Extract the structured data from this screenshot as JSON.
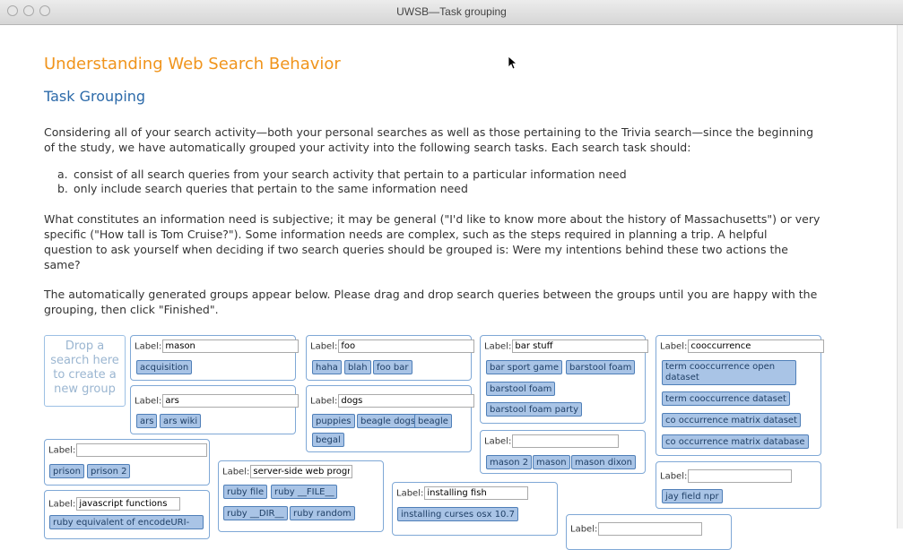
{
  "window": {
    "title": "UWSB—Task grouping"
  },
  "page": {
    "heading": "Understanding Web Search Behavior",
    "subheading": "Task Grouping",
    "intro_1": "Considering all of your search activity—both your personal searches as well as those pertaining to the Trivia search—since the beginning",
    "intro_2": "of the study, we have automatically grouped your activity into the following search tasks. Each search task should:",
    "criteria": [
      {
        "marker": "a.",
        "text": "consist of all search queries from your search activity that pertain to a particular information need"
      },
      {
        "marker": "b.",
        "text": "only include search queries that pertain to the same information need"
      }
    ],
    "info_1": "What constitutes an information need is subjective; it may be general (\"I'd like to know more about the history of Massachusetts\") or very",
    "info_2": "specific (\"How tall is Tom Cruise?\"). Some information needs are complex, such as the steps required in planning a trip. A helpful",
    "info_3": "question to ask yourself when deciding if two search queries should be grouped is: Were my intentions behind these two actions the",
    "info_4": "same?",
    "auto_1": "The automatically generated groups appear below. Please drag and drop search queries between the groups until you are happy with the",
    "auto_2": "grouping, then click \"Finished\".",
    "drop_zone": "Drop a search here to create a new group",
    "label_prefix": "Label:"
  },
  "groups": [
    {
      "label": "mason",
      "queries": [
        "acquisition"
      ]
    },
    {
      "label": "foo",
      "queries": [
        "haha",
        "blah",
        "foo bar"
      ]
    },
    {
      "label": "bar stuff",
      "queries": [
        "bar sport game",
        "barstool foam",
        "barstool foam",
        "barstool foam party"
      ]
    },
    {
      "label": "cooccurrence",
      "queries": [
        "term cooccurrence open dataset",
        "term cooccurrence dataset",
        "co occurrence matrix dataset",
        "co occurrence matrix database"
      ]
    },
    {
      "label": "ars",
      "queries": [
        "ars",
        "ars wiki"
      ]
    },
    {
      "label": "dogs",
      "queries": [
        "puppies",
        "beagle dogs",
        "beagle",
        "begal"
      ]
    },
    {
      "label": "",
      "queries": [
        "mason 2",
        "mason",
        "mason dixon"
      ]
    },
    {
      "label": "",
      "queries": [
        "jay field npr"
      ]
    },
    {
      "label": "",
      "queries": [
        "prison",
        "prison 2"
      ]
    },
    {
      "label": "server-side web progr",
      "queries": [
        "ruby file",
        "ruby __FILE__",
        "ruby __DIR__",
        "ruby random"
      ]
    },
    {
      "label": "installing fish",
      "queries": [
        "installing curses osx 10.7"
      ]
    },
    {
      "label": "javascript functions",
      "queries": [
        "ruby equivalent of encodeURI-"
      ]
    },
    {
      "label": "",
      "queries": []
    }
  ]
}
